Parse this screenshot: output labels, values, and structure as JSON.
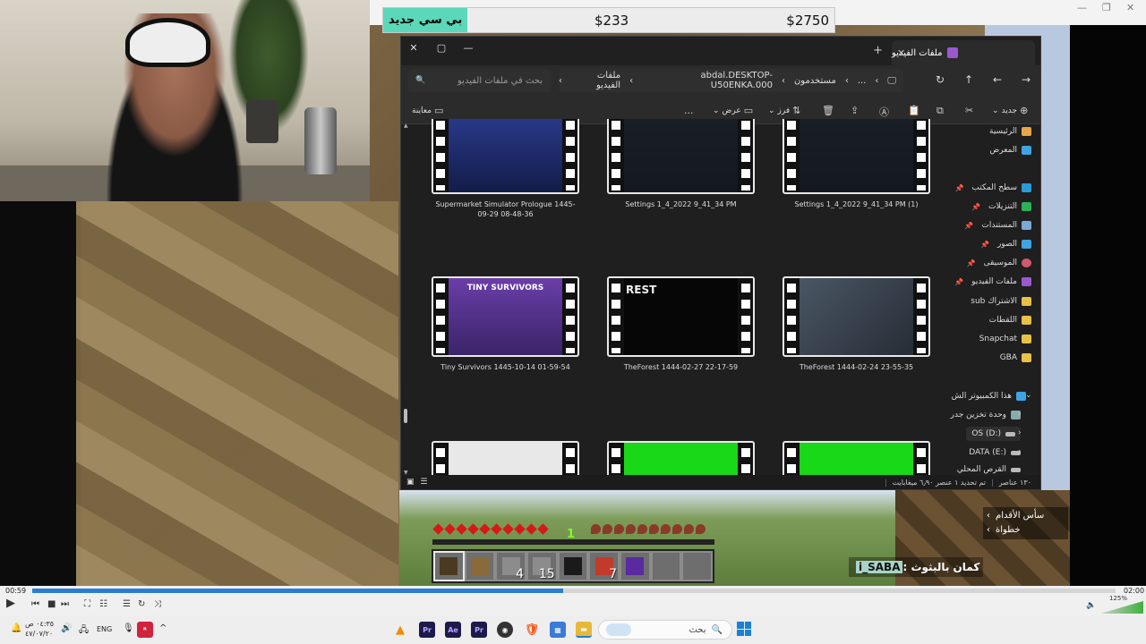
{
  "price_bar": {
    "badge": "بي سي جديد",
    "price_1": "$233",
    "price_2": "$2750"
  },
  "explorer": {
    "tab_title": "ملفات الفيديو",
    "breadcrumb": [
      "مستخدمون",
      "abdal.DESKTOP-U50ENKA.000",
      "ملفات الفيديو"
    ],
    "breadcrumb_more": "...",
    "search_placeholder": "بحث في ملفات الفيديو",
    "toolbar": {
      "new": "جديد",
      "sort": "فرز",
      "view": "عرض",
      "more": "...",
      "preview": "معاينة"
    },
    "files": [
      {
        "name": "Supermarket Simulator Prologue 1445-09-29 08-48-36",
        "color": "#1b2a6b"
      },
      {
        "name": "Settings 1_4_2022 9_41_34 PM",
        "color": "#1b1f27"
      },
      {
        "name": "Settings 1_4_2022 9_41_34 PM (1)",
        "color": "#1b1f27"
      },
      {
        "name": "Tiny Survivors 1445-10-14 01-59-54",
        "color": "#5b3a8a"
      },
      {
        "name": "TheForest 1444-02-27 22-17-59",
        "color": "#080808"
      },
      {
        "name": "TheForest 1444-02-24 23-55-35",
        "color": "#3b4552"
      },
      {
        "name": "",
        "color": "#dcdcdc"
      },
      {
        "name": "",
        "color": "#18d818"
      },
      {
        "name": "",
        "color": "#18d818"
      }
    ],
    "thumb_text": {
      "tiny": "TINY SURVIVORS",
      "forest": "REST"
    },
    "sidebar": {
      "home": "الرئيسية",
      "gallery": "المعرض",
      "pinned": [
        "سطح المكتب",
        "التنزيلات",
        "المستندات",
        "الصور",
        "الموسيقى",
        "ملفات الفيديو"
      ],
      "folders": [
        "الاشتراك sub",
        "اللقطات",
        "Snapchat",
        "GBA"
      ],
      "this_pc": "هذا الكمبيوتر الش",
      "drives": [
        "وحدة تخزين جدر",
        "OS (D:)",
        "DATA (E:)",
        "القرص المحلي"
      ]
    },
    "status": {
      "count": "١٣٠ عناصر",
      "selected": "تم تحديد ١ عنصر ٦٫٩٠ ميغابايت"
    },
    "colors": {
      "home": "#e8a54b",
      "gallery": "#3fa5e0",
      "desktop": "#2a9bd8",
      "downloads": "#2db05a",
      "documents": "#7aa7d8",
      "pictures": "#3fa5e0",
      "music": "#d05a70",
      "videos": "#9b59d0",
      "folder": "#e8c04a",
      "pc": "#3fa5e0"
    }
  },
  "hud": {
    "xp_level": "1",
    "slot_counts": [
      "",
      "",
      "4",
      "15",
      "",
      "7",
      "",
      "",
      ""
    ],
    "slot_colors": [
      "#4a3a22",
      "#8a6a3a",
      "#8c8c8c",
      "#8c8c8c",
      "#1a1a1a",
      "#c23b2a",
      "#5a2aa0",
      "#6e6e6e",
      "#6e6e6e"
    ],
    "hearts": 10,
    "food": 10
  },
  "mc_text": {
    "line1": "سأس الأقدام",
    "line2": "خطواة"
  },
  "chat": {
    "name": "i_SABA",
    "message": ": كمان بالبثوث"
  },
  "player": {
    "elapsed": "00:59",
    "total": "02:00",
    "progress": 0.49,
    "volume": "125%"
  },
  "taskbar": {
    "time": "٠٤:٣٥ ص",
    "date": "٤٧/٠٧/٢٠",
    "lang": "ENG",
    "search": "بحث"
  }
}
